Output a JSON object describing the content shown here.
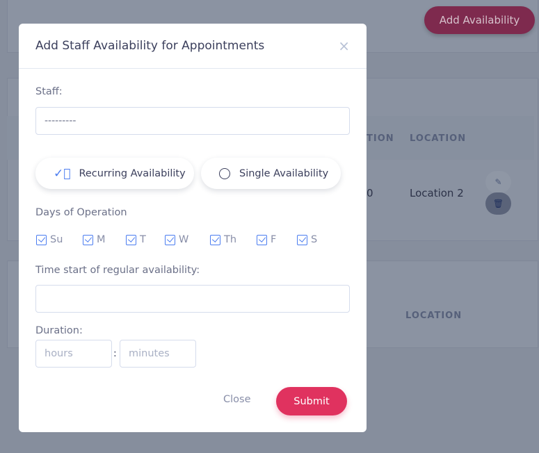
{
  "background": {
    "add_button": "Add Availability",
    "table1": {
      "headers": [
        "TION",
        "LOCATION"
      ],
      "row": {
        "cell_partial": "0",
        "location": "Location 2"
      }
    },
    "table2": {
      "headers": [
        "LOCATION"
      ]
    },
    "icons": [
      "edit-icon",
      "trash-icon"
    ]
  },
  "modal": {
    "title": "Add Staff Availability for Appointments",
    "close_icon": "×",
    "staff_label": "Staff:",
    "staff_value": "---------",
    "recurring_label": "Recurring Availability",
    "single_label": "Single Availability",
    "recurring_selected": true,
    "days_label": "Days of Operation",
    "days": [
      {
        "label": "Su",
        "checked": true
      },
      {
        "label": "M",
        "checked": true
      },
      {
        "label": "T",
        "checked": true
      },
      {
        "label": "W",
        "checked": true
      },
      {
        "label": "Th",
        "checked": true
      },
      {
        "label": "F",
        "checked": true
      },
      {
        "label": "S",
        "checked": true
      }
    ],
    "time_label": "Time start of regular availability:",
    "time_value": "",
    "duration_label": "Duration:",
    "hours_placeholder": "hours",
    "separator": ":",
    "minutes_placeholder": "minutes",
    "close_button": "Close",
    "submit_button": "Submit",
    "accent": "#e0325f",
    "check_color": "#4a7cf0"
  }
}
